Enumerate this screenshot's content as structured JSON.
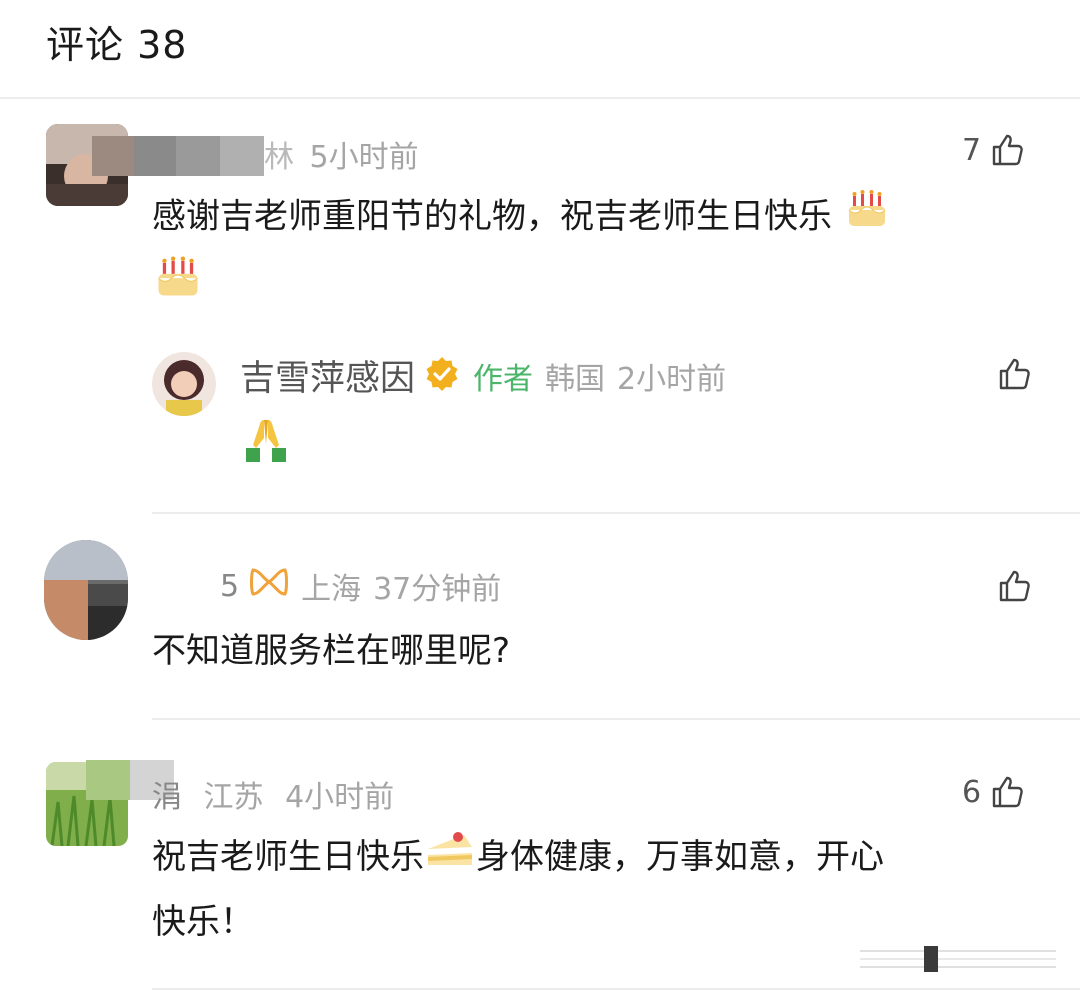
{
  "header": {
    "title": "评论 38"
  },
  "comments": [
    {
      "name_partial": "林",
      "time": "5小时前",
      "likes": "7",
      "text": "感谢吉老师重阳节的礼物，祝吉老师生日快乐"
    },
    {
      "reply": {
        "name": "吉雪萍感因",
        "badge": "作者",
        "location": "韩国",
        "time": "2小时前",
        "emoji": "folded-hands"
      }
    },
    {
      "name_partial": "5",
      "location": "上海",
      "time": "37分钟前",
      "text": "不知道服务栏在哪里呢?"
    },
    {
      "name_partial": "涓",
      "location": "江苏",
      "time": "4小时前",
      "likes": "6",
      "text_line1": "祝吉老师生日快乐",
      "text_line1b": "身体健康，万事如意，开心",
      "text_line2": "快乐！"
    }
  ],
  "icons": {
    "like": "thumbs-up-icon",
    "verified": "verified-badge-icon",
    "vip": "vip-icon"
  },
  "colors": {
    "accent_green": "#4bb56a",
    "meta_gray": "#a5a5a5",
    "verified_gold": "#f2b01e"
  }
}
